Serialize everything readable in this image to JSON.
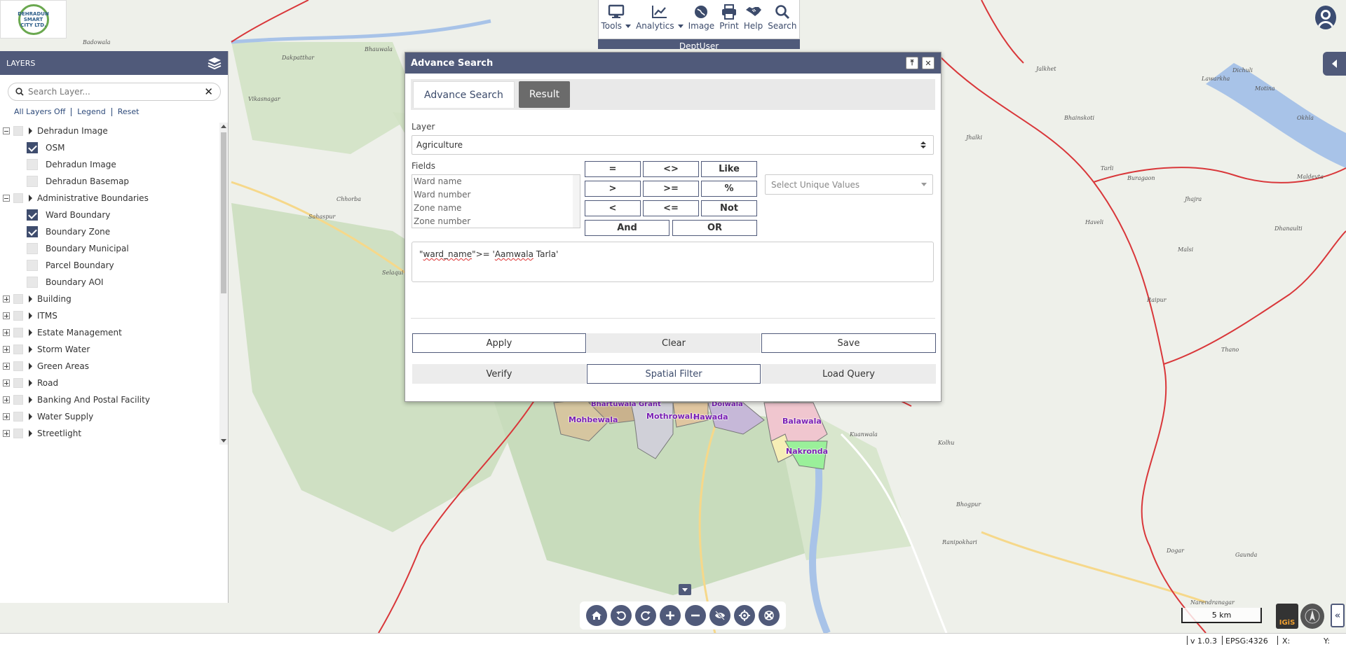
{
  "app": {
    "logo_text": "DEHRADUN SMART CITY LTD.",
    "dept_user": "DeptUser"
  },
  "toolbar": {
    "items": [
      {
        "label": "Tools",
        "icon": "monitor-icon",
        "dropdown": true
      },
      {
        "label": "Analytics",
        "icon": "chart-line-icon",
        "dropdown": true
      },
      {
        "label": "Image",
        "icon": "globe-icon",
        "dropdown": false
      },
      {
        "label": "Print",
        "icon": "printer-icon",
        "dropdown": false
      },
      {
        "label": "Help",
        "icon": "handshake-icon",
        "dropdown": false
      },
      {
        "label": "Search",
        "icon": "search-icon",
        "dropdown": false
      }
    ]
  },
  "layers_panel": {
    "title": "LAYERS",
    "search_placeholder": "Search Layer...",
    "links": {
      "all_off": "All Layers Off",
      "legend": "Legend",
      "reset": "Reset"
    },
    "tree": [
      {
        "type": "group",
        "label": "Dehradun Image",
        "expanded": true
      },
      {
        "type": "child",
        "label": "OSM",
        "checked": true
      },
      {
        "type": "child",
        "label": "Dehradun Image",
        "checked": false
      },
      {
        "type": "child",
        "label": "Dehradun Basemap",
        "checked": false
      },
      {
        "type": "group",
        "label": "Administrative Boundaries",
        "expanded": true
      },
      {
        "type": "child",
        "label": "Ward Boundary",
        "checked": true
      },
      {
        "type": "child",
        "label": "Boundary Zone",
        "checked": true
      },
      {
        "type": "child",
        "label": "Boundary Municipal",
        "checked": false
      },
      {
        "type": "child",
        "label": "Parcel Boundary",
        "checked": false
      },
      {
        "type": "child",
        "label": "Boundary AOI",
        "checked": false
      },
      {
        "type": "group",
        "label": "Building",
        "expanded": false
      },
      {
        "type": "group",
        "label": "ITMS",
        "expanded": false
      },
      {
        "type": "group",
        "label": "Estate Management",
        "expanded": false
      },
      {
        "type": "group",
        "label": "Storm Water",
        "expanded": false
      },
      {
        "type": "group",
        "label": "Green Areas",
        "expanded": false
      },
      {
        "type": "group",
        "label": "Road",
        "expanded": false
      },
      {
        "type": "group",
        "label": "Banking And Postal Facility",
        "expanded": false
      },
      {
        "type": "group",
        "label": "Water Supply",
        "expanded": false
      },
      {
        "type": "group",
        "label": "Streetlight",
        "expanded": false
      }
    ]
  },
  "dialog": {
    "title": "Advance Search",
    "tabs": [
      {
        "label": "Advance Search",
        "active": true
      },
      {
        "label": "Result",
        "active": false
      }
    ],
    "layer_label": "Layer",
    "layer_value": "Agriculture",
    "fields_label": "Fields",
    "fields": [
      "Ward name",
      "Ward number",
      "Zone name",
      "Zone number"
    ],
    "operators": {
      "eq": "=",
      "neq": "<>",
      "like": "Like",
      "gt": ">",
      "gte": ">=",
      "pct": "%",
      "lt": "<",
      "lte": "<=",
      "not": "Not",
      "and": "And",
      "or": "OR"
    },
    "unique_placeholder": "Select Unique Values",
    "query": {
      "p1": "\"",
      "p2": "ward_name",
      "p3": "\">= '",
      "p4": "Aamwala",
      "p5": " Tarla'"
    },
    "buttons": {
      "apply": "Apply",
      "clear": "Clear",
      "save": "Save",
      "verify": "Verify",
      "spatial_filter": "Spatial Filter",
      "load_query": "Load Query"
    }
  },
  "map": {
    "ward_labels": [
      "Bhartuwala Grant",
      "Mohbewala",
      "Mothrowala",
      "Hawada",
      "Balawala",
      "Nakronda",
      "Doiwala"
    ],
    "place_labels": [
      "Dakpatthar",
      "Vikasnagar",
      "Sahaspur",
      "Selaqui",
      "Chhorba",
      "Jhajra",
      "Bhainskoti",
      "Malsi",
      "Dhanaulti",
      "Raipur",
      "Maldevta",
      "Thano",
      "Haveli",
      "Bhogpur",
      "Dogar",
      "Ranipokhari",
      "Gaunda",
      "Narendranagar",
      "Kuanwala",
      "Badowala",
      "Bhauwala",
      "Tarli",
      "Jhalki",
      "Jalkhet",
      "Dichuli",
      "Motina",
      "Okhla",
      "Buragaon",
      "Lawarkha",
      "Kolhu"
    ],
    "scale": "5 km",
    "colors": {
      "boundary": "#d9373a",
      "river": "#a8c3e8",
      "ward_label": "#7a1fb5"
    }
  },
  "status_bar": {
    "version": "v 1.0.3",
    "epsg": "EPSG:4326",
    "x_label": "X:",
    "y_label": "Y:"
  },
  "badges": {
    "igis": "IGiS"
  },
  "accent_color": "#505a7a"
}
